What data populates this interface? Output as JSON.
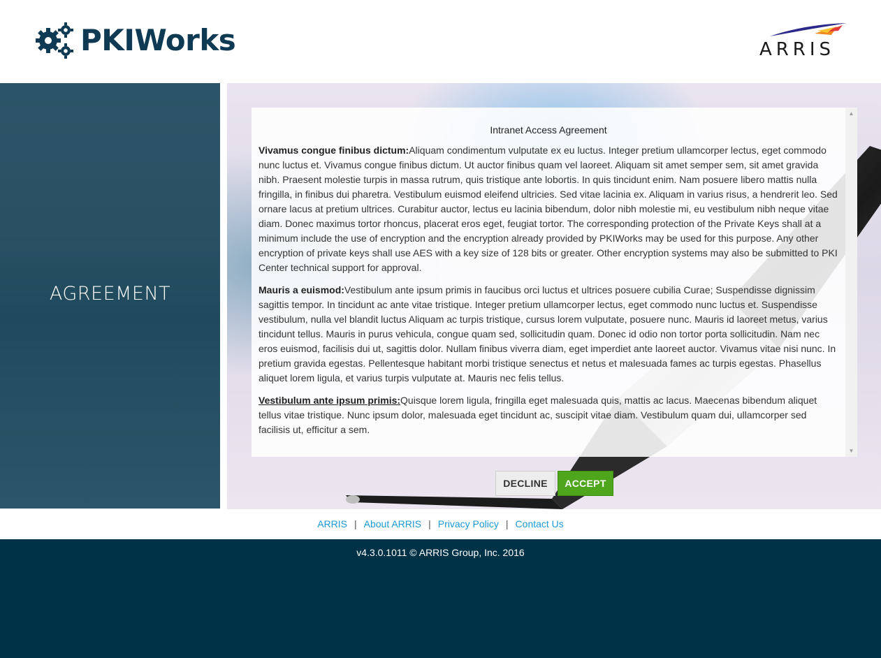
{
  "header": {
    "app_name": "PKIWorks",
    "logo_text": "ARRIS",
    "logo_icon": "gears-icon"
  },
  "sidebar": {
    "title": "AGREEMENT"
  },
  "agreement": {
    "heading": "Intranet Access Agreement",
    "paragraphs": [
      {
        "lead": "Vivamus congue finibus dictum:",
        "body": "Aliquam condimentum vulputate ex eu luctus. Integer pretium ullamcorper lectus, eget commodo nunc luctus et.   Vivamus congue finibus dictum. Ut auctor finibus quam vel laoreet. Aliquam sit amet semper sem, sit amet gravida nibh. Praesent molestie turpis in massa rutrum, quis tristique ante lobortis. In quis tincidunt enim. Nam posuere libero mattis nulla fringilla, in finibus dui pharetra. Vestibulum euismod eleifend ultricies. Sed vitae lacinia ex. Aliquam in varius risus, a hendrerit leo. Sed ornare lacus at pretium ultrices. Curabitur auctor, lectus eu lacinia bibendum, dolor nibh molestie mi, eu vestibulum nibh neque vitae diam. Donec maximus tortor rhoncus, placerat eros eget, feugiat tortor.  The corresponding protection of the Private Keys shall at a minimum include the use of encryption and the encryption already provided by PKIWorks may be used for this purpose.  Any other encryption of private keys shall use AES with a key size of 128 bits or greater.  Other encryption systems may also be submitted to PKI Center technical support for approval."
      },
      {
        "lead": "Mauris a euismod:",
        "body": "Vestibulum ante ipsum primis in faucibus orci luctus et ultrices posuere cubilia Curae; Suspendisse dignissim sagittis tempor. In tincidunt ac ante vitae tristique.  Integer pretium ullamcorper lectus, eget commodo nunc luctus et. Suspendisse vestibulum, nulla vel blandit luctus  Aliquam ac turpis tristique, cursus lorem vulputate, posuere nunc. Mauris id laoreet metus, varius tincidunt tellus. Mauris in purus vehicula, congue quam sed, sollicitudin quam. Donec id odio non tortor porta sollicitudin.  Nam nec eros euismod, facilisis dui ut, sagittis dolor. Nullam finibus viverra diam, eget imperdiet ante laoreet auctor.  Vivamus vitae nisi nunc. In pretium gravida egestas. Pellentesque habitant morbi tristique senectus et netus et malesuada fames ac turpis egestas. Phasellus aliquet lorem ligula, et varius turpis vulputate at. Mauris nec felis tellus."
      },
      {
        "lead": "Vestibulum ante ipsum primis:",
        "body": "Quisque lorem ligula, fringilla eget malesuada quis, mattis ac lacus. Maecenas bibendum aliquet tellus vitae tristique. Nunc ipsum dolor, malesuada eget tincidunt ac, suscipit vitae diam. Vestibulum quam dui, ullamcorper sed facilisis ut, efficitur a sem."
      }
    ]
  },
  "buttons": {
    "decline": "DECLINE",
    "accept": "ACCEPT"
  },
  "footer_links": [
    "ARRIS",
    "About ARRIS",
    "Privacy Policy",
    "Contact Us"
  ],
  "footer": {
    "copyright": "v4.3.0.1011 © ARRIS Group, Inc. 2016"
  },
  "colors": {
    "brand": "#0e3a54",
    "accept": "#4fa51c",
    "link": "#1b9ad6",
    "footer_bg": "#003247",
    "sidebar_bg": "#2a5063"
  }
}
